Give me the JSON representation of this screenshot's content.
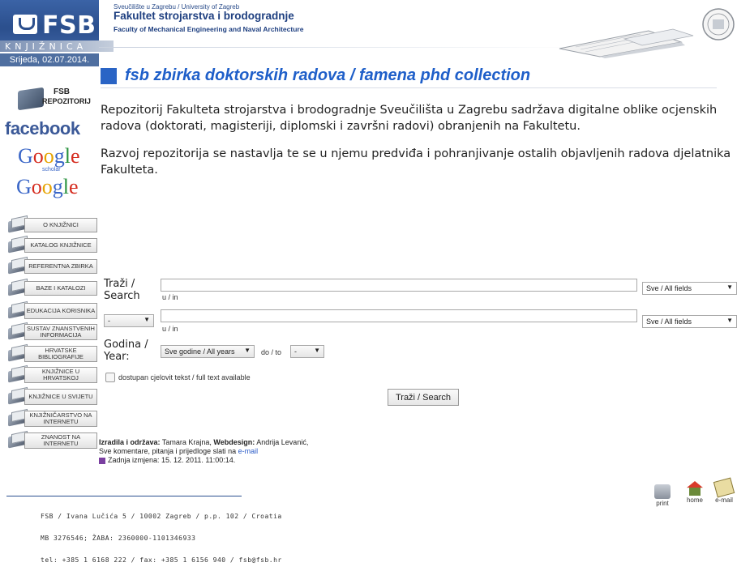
{
  "header": {
    "logo": "FSB",
    "knjiznica": "KNJIŽNICA",
    "date": "Srijeda, 02.07.2014.",
    "university": "Sveučilište u Zagrebu / University of Zagreb",
    "faculty_hr": "Fakultet strojarstva i brodogradnje",
    "faculty_en": "Faculty of Mechanical Engineering and Naval Architecture"
  },
  "title": "fsb zbirka doktorskih radova / famena phd collection",
  "sidebar": {
    "repo_line1": "FSB",
    "repo_line2": "REPOZITORIJ",
    "facebook": "facebook",
    "google_scholar_sub": "scholar",
    "nav": [
      {
        "label": "O KNJIŽNICI"
      },
      {
        "label": "KATALOG KNJIŽNICE"
      },
      {
        "label": "REFERENTNA ZBIRKA"
      },
      {
        "label": "BAZE I KATALOZI"
      },
      {
        "label": "EDUKACIJA KORISNIKA"
      },
      {
        "label": "SUSTAV ZNANSTVENIH INFORMACIJA"
      },
      {
        "label": "HRVATSKE BIBLIOGRAFIJE"
      },
      {
        "label": "KNJIŽNICE U HRVATSKOJ"
      },
      {
        "label": "KNJIŽNICE U SVIJETU"
      },
      {
        "label": "KNJIŽNIČARSTVO NA INTERNETU"
      },
      {
        "label": "ZNANOST NA INTERNETU"
      }
    ]
  },
  "intro": {
    "p1": "Repozitorij Fakulteta strojarstva i brodogradnje Sveučilišta u Zagrebu sadržava digitalne oblike ocjenskih radova (doktorati, magisteriji, diplomski i završni radovi) obranjenih na Fakultetu.",
    "p2": "Razvoj repozitorija se nastavlja te se u njemu predviđa i pohranjivanje ostalih objavljenih radova djelatnika Fakulteta."
  },
  "search": {
    "label_line1": "Traži /",
    "label_line2": "Search",
    "in_label": "u / in",
    "field1_value": "",
    "field2_value": "",
    "field_select1": "Sve / All fields",
    "field_select2": "Sve / All fields",
    "operator_select": "-",
    "year_label_line1": "Godina /",
    "year_label_line2": "Year:",
    "year_select": "Sve godine / All years",
    "to_label": "do / to",
    "to_select": "-",
    "fulltext_label": "dostupan cjelovit tekst / full text available",
    "button": "Traži / Search"
  },
  "credits": {
    "made_label": "Izradila i održava:",
    "made_name": "Tamara Krajna,",
    "design_label": "Webdesign:",
    "design_name": "Andrija Levanić,",
    "comments": "Sve komentare, pitanja i prijedloge slati na",
    "email_link": "e-mail",
    "updated": "Zadnja izmjena: 15. 12. 2011. 11:00:14."
  },
  "footer": {
    "line1": "FSB / Ivana Lučića 5 / 10002 Zagreb / p.p. 102 / Croatia",
    "line2": "MB 3276546; ŽABA: 2360000-1101346933",
    "line3": "tel: +385 1 6168 222 / fax: +385 1 6156 940 / fsb@fsb.hr",
    "print": "print",
    "home": "home",
    "email": "e-mail"
  },
  "colors": {
    "brand_blue": "#2b4f8d",
    "title_blue": "#1f5fc9",
    "facebook_blue": "#3b5998"
  }
}
